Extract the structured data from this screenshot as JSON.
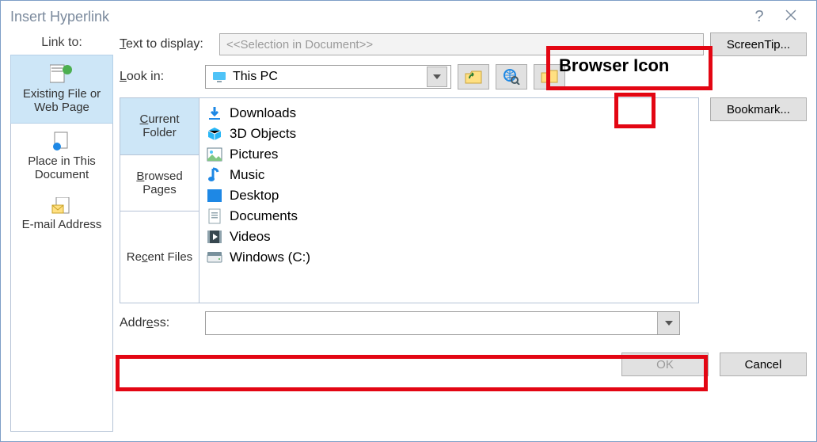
{
  "title": "Insert Hyperlink",
  "linkto": {
    "header": "Link to:",
    "items": [
      {
        "label": "Existing File or Web Page",
        "selected": true,
        "icon": "globe-page-icon"
      },
      {
        "label": "Place in This Document",
        "selected": false,
        "icon": "doc-place-icon"
      },
      {
        "label": "E-mail Address",
        "selected": false,
        "icon": "mail-icon"
      }
    ]
  },
  "text_to_display": {
    "label_html": "<u>T</u>ext to display:",
    "value": "<<Selection in Document>>"
  },
  "screentip_label": "ScreenTip...",
  "bookmark_label": "Bookmark...",
  "lookin": {
    "label_html": "<u>L</u>ook in:",
    "value": "This PC"
  },
  "toolbar": {
    "up_icon": "folder-up-icon",
    "browse_web_icon": "browse-web-icon",
    "browse_file_icon": "browse-file-icon"
  },
  "tabs": [
    {
      "label_html": "<u>C</u>urrent<br>Folder",
      "selected": true
    },
    {
      "label_html": "<u>B</u>rowsed<br>Pages",
      "selected": false
    },
    {
      "label_html": "Re<u>c</u>ent Files",
      "selected": false
    }
  ],
  "files": [
    {
      "label": "Downloads",
      "icon": "download-icon",
      "color": "#1e88e5"
    },
    {
      "label": "3D Objects",
      "icon": "cube-icon",
      "color": "#29b6f6"
    },
    {
      "label": "Pictures",
      "icon": "pictures-icon",
      "color": "#607d8b"
    },
    {
      "label": "Music",
      "icon": "music-icon",
      "color": "#1e88e5"
    },
    {
      "label": "Desktop",
      "icon": "desktop-icon",
      "color": "#1e88e5"
    },
    {
      "label": "Documents",
      "icon": "documents-icon",
      "color": "#90a4ae"
    },
    {
      "label": "Videos",
      "icon": "videos-icon",
      "color": "#37474f"
    },
    {
      "label": "Windows (C:)",
      "icon": "drive-icon",
      "color": "#78909c"
    }
  ],
  "address": {
    "label_html": "Addr<u>e</u>ss:",
    "value": ""
  },
  "footer": {
    "ok": "OK",
    "cancel": "Cancel"
  },
  "annotations": {
    "browser_icon_label": "Browser Icon"
  }
}
